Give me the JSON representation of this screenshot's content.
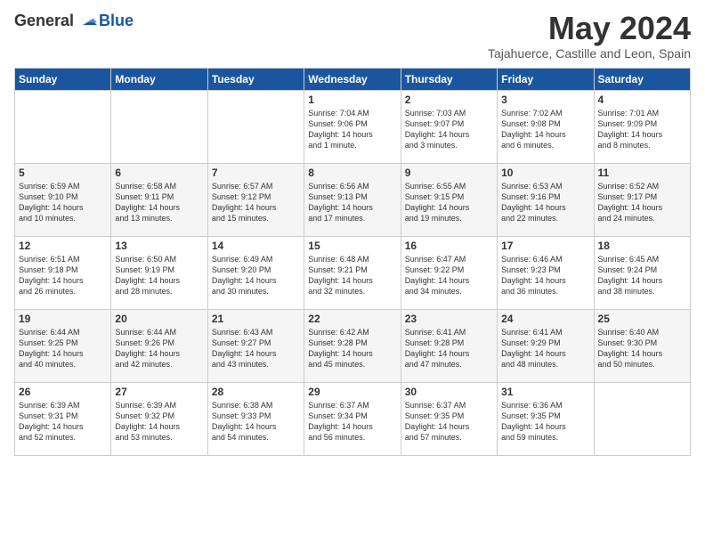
{
  "logo": {
    "general": "General",
    "blue": "Blue"
  },
  "header": {
    "month": "May 2024",
    "location": "Tajahuerce, Castille and Leon, Spain"
  },
  "days": [
    "Sunday",
    "Monday",
    "Tuesday",
    "Wednesday",
    "Thursday",
    "Friday",
    "Saturday"
  ],
  "weeks": [
    [
      {
        "num": "",
        "content": ""
      },
      {
        "num": "",
        "content": ""
      },
      {
        "num": "",
        "content": ""
      },
      {
        "num": "1",
        "content": "Sunrise: 7:04 AM\nSunset: 9:06 PM\nDaylight: 14 hours\nand 1 minute."
      },
      {
        "num": "2",
        "content": "Sunrise: 7:03 AM\nSunset: 9:07 PM\nDaylight: 14 hours\nand 3 minutes."
      },
      {
        "num": "3",
        "content": "Sunrise: 7:02 AM\nSunset: 9:08 PM\nDaylight: 14 hours\nand 6 minutes."
      },
      {
        "num": "4",
        "content": "Sunrise: 7:01 AM\nSunset: 9:09 PM\nDaylight: 14 hours\nand 8 minutes."
      }
    ],
    [
      {
        "num": "5",
        "content": "Sunrise: 6:59 AM\nSunset: 9:10 PM\nDaylight: 14 hours\nand 10 minutes."
      },
      {
        "num": "6",
        "content": "Sunrise: 6:58 AM\nSunset: 9:11 PM\nDaylight: 14 hours\nand 13 minutes."
      },
      {
        "num": "7",
        "content": "Sunrise: 6:57 AM\nSunset: 9:12 PM\nDaylight: 14 hours\nand 15 minutes."
      },
      {
        "num": "8",
        "content": "Sunrise: 6:56 AM\nSunset: 9:13 PM\nDaylight: 14 hours\nand 17 minutes."
      },
      {
        "num": "9",
        "content": "Sunrise: 6:55 AM\nSunset: 9:15 PM\nDaylight: 14 hours\nand 19 minutes."
      },
      {
        "num": "10",
        "content": "Sunrise: 6:53 AM\nSunset: 9:16 PM\nDaylight: 14 hours\nand 22 minutes."
      },
      {
        "num": "11",
        "content": "Sunrise: 6:52 AM\nSunset: 9:17 PM\nDaylight: 14 hours\nand 24 minutes."
      }
    ],
    [
      {
        "num": "12",
        "content": "Sunrise: 6:51 AM\nSunset: 9:18 PM\nDaylight: 14 hours\nand 26 minutes."
      },
      {
        "num": "13",
        "content": "Sunrise: 6:50 AM\nSunset: 9:19 PM\nDaylight: 14 hours\nand 28 minutes."
      },
      {
        "num": "14",
        "content": "Sunrise: 6:49 AM\nSunset: 9:20 PM\nDaylight: 14 hours\nand 30 minutes."
      },
      {
        "num": "15",
        "content": "Sunrise: 6:48 AM\nSunset: 9:21 PM\nDaylight: 14 hours\nand 32 minutes."
      },
      {
        "num": "16",
        "content": "Sunrise: 6:47 AM\nSunset: 9:22 PM\nDaylight: 14 hours\nand 34 minutes."
      },
      {
        "num": "17",
        "content": "Sunrise: 6:46 AM\nSunset: 9:23 PM\nDaylight: 14 hours\nand 36 minutes."
      },
      {
        "num": "18",
        "content": "Sunrise: 6:45 AM\nSunset: 9:24 PM\nDaylight: 14 hours\nand 38 minutes."
      }
    ],
    [
      {
        "num": "19",
        "content": "Sunrise: 6:44 AM\nSunset: 9:25 PM\nDaylight: 14 hours\nand 40 minutes."
      },
      {
        "num": "20",
        "content": "Sunrise: 6:44 AM\nSunset: 9:26 PM\nDaylight: 14 hours\nand 42 minutes."
      },
      {
        "num": "21",
        "content": "Sunrise: 6:43 AM\nSunset: 9:27 PM\nDaylight: 14 hours\nand 43 minutes."
      },
      {
        "num": "22",
        "content": "Sunrise: 6:42 AM\nSunset: 9:28 PM\nDaylight: 14 hours\nand 45 minutes."
      },
      {
        "num": "23",
        "content": "Sunrise: 6:41 AM\nSunset: 9:28 PM\nDaylight: 14 hours\nand 47 minutes."
      },
      {
        "num": "24",
        "content": "Sunrise: 6:41 AM\nSunset: 9:29 PM\nDaylight: 14 hours\nand 48 minutes."
      },
      {
        "num": "25",
        "content": "Sunrise: 6:40 AM\nSunset: 9:30 PM\nDaylight: 14 hours\nand 50 minutes."
      }
    ],
    [
      {
        "num": "26",
        "content": "Sunrise: 6:39 AM\nSunset: 9:31 PM\nDaylight: 14 hours\nand 52 minutes."
      },
      {
        "num": "27",
        "content": "Sunrise: 6:39 AM\nSunset: 9:32 PM\nDaylight: 14 hours\nand 53 minutes."
      },
      {
        "num": "28",
        "content": "Sunrise: 6:38 AM\nSunset: 9:33 PM\nDaylight: 14 hours\nand 54 minutes."
      },
      {
        "num": "29",
        "content": "Sunrise: 6:37 AM\nSunset: 9:34 PM\nDaylight: 14 hours\nand 56 minutes."
      },
      {
        "num": "30",
        "content": "Sunrise: 6:37 AM\nSunset: 9:35 PM\nDaylight: 14 hours\nand 57 minutes."
      },
      {
        "num": "31",
        "content": "Sunrise: 6:36 AM\nSunset: 9:35 PM\nDaylight: 14 hours\nand 59 minutes."
      },
      {
        "num": "",
        "content": ""
      }
    ]
  ]
}
